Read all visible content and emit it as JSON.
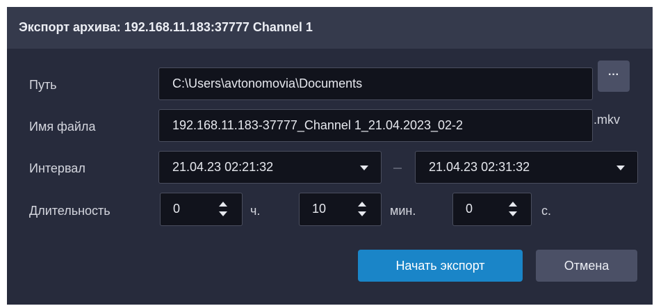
{
  "dialog": {
    "title": "Экспорт архива: 192.168.11.183:37777 Channel 1"
  },
  "path": {
    "label": "Путь",
    "value": "C:\\Users\\avtonomovia\\Documents",
    "browse_label": "···"
  },
  "filename": {
    "label": "Имя файла",
    "value": "192.168.11.183-37777_Channel 1_21.04.2023_02-2",
    "extension": ".mkv"
  },
  "interval": {
    "label": "Интервал",
    "start": "21.04.23  02:21:32",
    "end": "21.04.23  02:31:32"
  },
  "duration": {
    "label": "Длительность",
    "hours": {
      "value": "0",
      "unit": "ч."
    },
    "minutes": {
      "value": "10",
      "unit": "мин."
    },
    "seconds": {
      "value": "0",
      "unit": "с."
    }
  },
  "buttons": {
    "start_export": "Начать экспорт",
    "cancel": "Отмена"
  },
  "colors": {
    "dialog_bg": "#272b3c",
    "titlebar_bg": "#353a4c",
    "field_bg": "#11131c",
    "accent": "#1a85c8",
    "secondary_button": "#4b5066"
  },
  "icons": {
    "browse": "ellipsis-icon",
    "dropdown": "caret-down-icon",
    "spinner": "up-down-arrows-icon"
  }
}
